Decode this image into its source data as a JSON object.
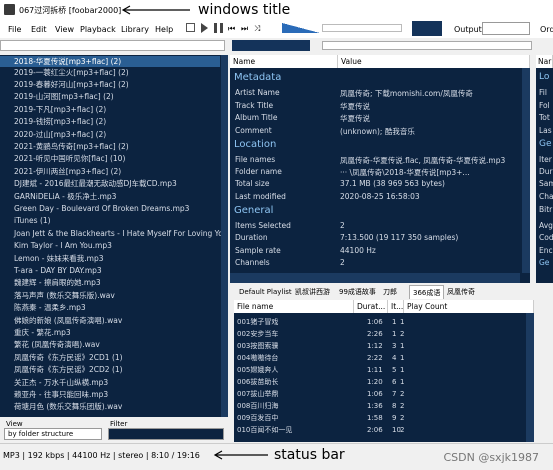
{
  "window": {
    "title": "067过河拆桥 [foobar2000]",
    "title_annotation": "windows title"
  },
  "menu": [
    "File",
    "Edit",
    "View",
    "Playback",
    "Library",
    "Help"
  ],
  "output": {
    "label": "Output:",
    "value": ""
  },
  "album_list": {
    "items": [
      {
        "label": "2018-华夏传说[mp3+flac] (2)",
        "selected": true
      },
      {
        "label": "2019-一蓑红尘火[mp3+flac] (2)"
      },
      {
        "label": "2019-春暮好河山[mp3+flac] (2)"
      },
      {
        "label": "2019-山河图[mp3+flac] (2)"
      },
      {
        "label": "2019-下凡[mp3+flac] (2)"
      },
      {
        "label": "2019-钱捞[mp3+flac] (2)"
      },
      {
        "label": "2020-过山[mp3+flac] (2)"
      },
      {
        "label": "2021-黄鹂鸟传奇[mp3+flac] (2)"
      },
      {
        "label": "2021-听见中国听见你[flac] (10)"
      },
      {
        "label": "2021-伊川两丝[mp3+flac] (2)"
      },
      {
        "label": "DJ建斌 - 2016最红最潮无敌动感DJ车载CD.mp3"
      },
      {
        "label": "GARNiDELiA - 极乐净土.mp3"
      },
      {
        "label": "Green Day - Boulevard Of Broken Dreams.mp3"
      },
      {
        "label": "iTunes (1)"
      },
      {
        "label": "Joan Jett & the Blackhearts - I Hate Myself For Loving You"
      },
      {
        "label": "Kim Taylor - I Am You.mp3"
      },
      {
        "label": "Lemon - 妹妹来看我.mp3"
      },
      {
        "label": "T-ara - DAY BY DAY.mp3"
      },
      {
        "label": "魏建辉 - 擦肩眼的她.mp3"
      },
      {
        "label": "落马声声 (数乐交舞乐版).wav"
      },
      {
        "label": "陈燕秦 - 温柔乡.mp3"
      },
      {
        "label": "佛娘的新娘 (凤凰传奇演唱).wav"
      },
      {
        "label": "重庆 - 繁花.mp3"
      },
      {
        "label": "繁花 (凤凰传奇演唱).wav"
      },
      {
        "label": "凤凰传奇《东方民谣》2CD1 (1)"
      },
      {
        "label": "凤凰传奇《东方民谣》2CD2 (1)"
      },
      {
        "label": "关正杰 - 万水千山纵横.mp3"
      },
      {
        "label": "赖亚舟 - 往事只能回味.mp3"
      },
      {
        "label": "荷塘月色 (数乐交舞乐团版).wav"
      }
    ],
    "view_label": "View",
    "view_value": "by folder structure",
    "filter_label": "Filter",
    "filter_value": ""
  },
  "properties": {
    "col_name": "Name",
    "col_value": "Value",
    "sections": [
      {
        "title": "Metadata",
        "rows": [
          {
            "name": "Artist Name",
            "value": "凤凰传奇; 下载momishi.com/凤凰传奇"
          },
          {
            "name": "Track Title",
            "value": "华夏传说"
          },
          {
            "name": "Album Title",
            "value": "华夏传说"
          },
          {
            "name": "Comment",
            "value": "(unknown); 酷我音乐"
          }
        ]
      },
      {
        "title": "Location",
        "rows": [
          {
            "name": "File names",
            "value": "凤凰传奇-华夏传说.flac, 凤凰传奇-华夏传说.mp3"
          },
          {
            "name": "Folder name",
            "value": "··· \\凤凰传奇\\2018-华夏传说[mp3+..."
          },
          {
            "name": "Total size",
            "value": "37.1 MB (38 969 563 bytes)"
          },
          {
            "name": "Last modified",
            "value": "2020-08-25 16:58:03"
          }
        ]
      },
      {
        "title": "General",
        "rows": [
          {
            "name": "Items Selected",
            "value": "2"
          },
          {
            "name": "Duration",
            "value": "7:13.500 (19 117 350 samples)"
          },
          {
            "name": "Sample rate",
            "value": "44100 Hz"
          },
          {
            "name": "Channels",
            "value": "2"
          }
        ]
      }
    ]
  },
  "right_strip": {
    "col": "Nar",
    "items": [
      "Lo",
      "Fil",
      "Fol",
      "Tot",
      "Las",
      "Ge",
      "Iter",
      "Dur",
      "Sam",
      "Cha",
      "Bitr",
      "Avg",
      "Cod",
      "Enc",
      "Ge"
    ]
  },
  "playlist_tabs": [
    "Default Playlist",
    "凯叔讲西游",
    "99成语故事",
    "刀郎",
    "366成语",
    "凤凰传奇"
  ],
  "active_tab_index": 4,
  "playlist": {
    "columns": [
      "File name",
      "Durat...",
      "It...",
      "Play Count"
    ],
    "rows": [
      {
        "file": "001猪子冒戏",
        "dur": "1:06",
        "it": "1",
        "pc": "1"
      },
      {
        "file": "002安步当车",
        "dur": "2:26",
        "it": "1",
        "pc": "2"
      },
      {
        "file": "003按图索骥",
        "dur": "1:12",
        "it": "3",
        "pc": "1"
      },
      {
        "file": "004嗷嗷待台",
        "dur": "2:22",
        "it": "4",
        "pc": "1"
      },
      {
        "file": "005嫦娥奔人",
        "dur": "1:11",
        "it": "5",
        "pc": "1"
      },
      {
        "file": "006拔苗助长",
        "dur": "1:20",
        "it": "6",
        "pc": "1"
      },
      {
        "file": "007拔山举鼎",
        "dur": "1:06",
        "it": "7",
        "pc": "2"
      },
      {
        "file": "008百川归海",
        "dur": "1:36",
        "it": "8",
        "pc": "2"
      },
      {
        "file": "009百发百中",
        "dur": "1:58",
        "it": "9",
        "pc": "2"
      },
      {
        "file": "010百闻不如一见",
        "dur": "2:06",
        "it": "10",
        "pc": "2"
      }
    ]
  },
  "status": {
    "text": "MP3 | 192 kbps | 44100 Hz | stereo | 8:10 / 19:16",
    "annotation": "status bar"
  },
  "watermark": "CSDN @sxjk1987",
  "order_label": "Ord"
}
